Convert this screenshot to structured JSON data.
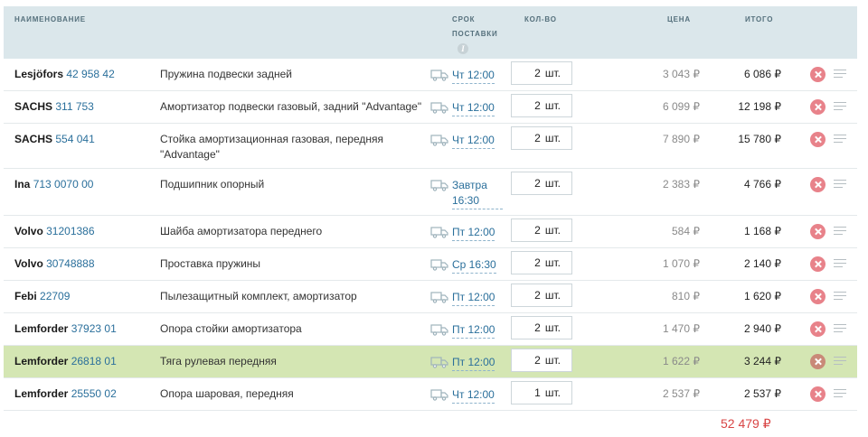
{
  "header": {
    "name": "НАИМЕНОВАНИЕ",
    "term": "СРОК ПОСТАВКИ",
    "term_info": "i",
    "qty": "КОЛ-ВО",
    "price": "ЦЕНА",
    "total": "ИТОГО"
  },
  "items": [
    {
      "brand": "Lesjöfors",
      "article": "42 958 42",
      "name": "Пружина подвески задней",
      "term": "Чт 12:00",
      "qty": "2",
      "unit": "шт.",
      "price": "3 043 ₽",
      "total": "6 086 ₽"
    },
    {
      "brand": "SACHS",
      "article": "311 753",
      "name": "Амортизатор подвески газовый, задний \"Advantage\"",
      "term": "Чт 12:00",
      "qty": "2",
      "unit": "шт.",
      "price": "6 099 ₽",
      "total": "12 198 ₽"
    },
    {
      "brand": "SACHS",
      "article": "554 041",
      "name": "Стойка амортизационная газовая, передняя \"Advantage\"",
      "term": "Чт 12:00",
      "qty": "2",
      "unit": "шт.",
      "price": "7 890 ₽",
      "total": "15 780 ₽"
    },
    {
      "brand": "Ina",
      "article": "713 0070 00",
      "name": "Подшипник опорный",
      "term": "Завтра 16:30",
      "qty": "2",
      "unit": "шт.",
      "price": "2 383 ₽",
      "total": "4 766 ₽"
    },
    {
      "brand": "Volvo",
      "article": "31201386",
      "name": "Шайба амортизатора переднего",
      "term": "Пт 12:00",
      "qty": "2",
      "unit": "шт.",
      "price": "584 ₽",
      "total": "1 168 ₽"
    },
    {
      "brand": "Volvo",
      "article": "30748888",
      "name": "Проставка пружины",
      "term": "Ср 16:30",
      "qty": "2",
      "unit": "шт.",
      "price": "1 070 ₽",
      "total": "2 140 ₽"
    },
    {
      "brand": "Febi",
      "article": "22709",
      "name": "Пылезащитный комплект, амортизатор",
      "term": "Пт 12:00",
      "qty": "2",
      "unit": "шт.",
      "price": "810 ₽",
      "total": "1 620 ₽"
    },
    {
      "brand": "Lemforder",
      "article": "37923 01",
      "name": "Опора стойки амортизатора",
      "term": "Пт 12:00",
      "qty": "2",
      "unit": "шт.",
      "price": "1 470 ₽",
      "total": "2 940 ₽"
    },
    {
      "brand": "Lemforder",
      "article": "26818 01",
      "name": "Тяга рулевая передняя",
      "term": "Пт 12:00",
      "qty": "2",
      "unit": "шт.",
      "price": "1 622 ₽",
      "total": "3 244 ₽"
    },
    {
      "brand": "Lemforder",
      "article": "25550 02",
      "name": "Опора шаровая, передняя",
      "term": "Чт 12:00",
      "qty": "1",
      "unit": "шт.",
      "price": "2 537 ₽",
      "total": "2 537 ₽"
    }
  ],
  "summary": {
    "grand_total": "52 479 ₽"
  },
  "colors": {
    "header_bg": "#dbe7eb",
    "highlight_row": "#d4e6b3",
    "link": "#2a6f9b",
    "delete": "#e8828a",
    "grand_total": "#d84444"
  },
  "icons": {
    "delivery": "truck-icon",
    "remove": "close-circle-icon",
    "reorder": "drag-handle-icon",
    "info": "info-icon"
  }
}
